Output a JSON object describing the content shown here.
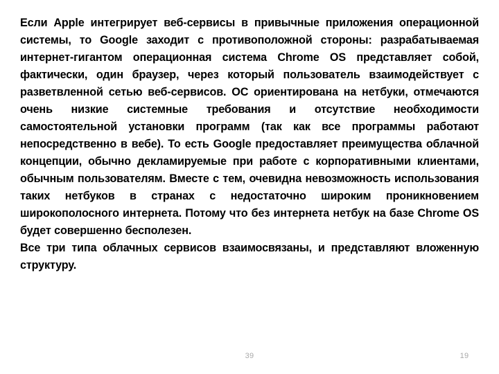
{
  "slide": {
    "background_color": "#ffffff",
    "text_color": "#000000",
    "footer_color": "#a9a9a9"
  },
  "content": {
    "paragraphs": [
      "Если Apple интегрирует веб-сервисы в привычные приложения операционной системы, то Google заходит с противоположной стороны: разрабатываемая интернет-гигантом операционная система Chrome OS представляет собой, фактически, один браузер, через который пользователь взаимодействует с разветвленной сетью веб-сервисов. ОС ориентирована на нетбуки, отмечаются очень низкие системные требования и отсутствие необходимости самостоятельной установки программ (так как все программы работают непосредственно в вебе). То есть Google предоставляет преимущества облачной концепции, обычно декламируемые при работе с корпоративными клиентами, обычным пользователям. Вместе с тем, очевидна невозможность использования таких нетбуков в странах с недостаточно широким проникновением широкополосного интернета. Потому что без интернета нетбук на базе Chrome OS будет совершенно бесполезен.",
      "Все три типа облачных сервисов взаимосвязаны, и представляют вложенную структуру."
    ]
  },
  "footer": {
    "slide_number": "39",
    "page_number": "19"
  }
}
